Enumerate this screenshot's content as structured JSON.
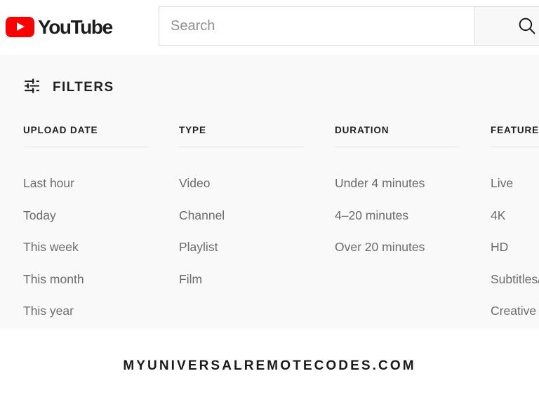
{
  "header": {
    "logo_text": "YouTube",
    "logo_color": "#ff0000",
    "search": {
      "placeholder": "Search",
      "value": "",
      "button_icon": "search-icon"
    }
  },
  "filters": {
    "icon": "tune-icon",
    "title": "FILTERS",
    "columns": [
      {
        "header": "UPLOAD DATE",
        "items": [
          "Last hour",
          "Today",
          "This week",
          "This month",
          "This year"
        ]
      },
      {
        "header": "TYPE",
        "items": [
          "Video",
          "Channel",
          "Playlist",
          "Film"
        ]
      },
      {
        "header": "DURATION",
        "items": [
          "Under 4 minutes",
          "4–20 minutes",
          "Over 20 minutes"
        ]
      },
      {
        "header": "FEATURES",
        "items": [
          "Live",
          "4K",
          "HD",
          "Subtitles/CC",
          "Creative Commons"
        ]
      }
    ]
  },
  "footer": {
    "watermark": "MYUNIVERSALREMOTECODES.COM"
  },
  "colors": {
    "panel_background": "#f9f9f9",
    "item_text": "#6b6b6b",
    "header_text": "#212121",
    "rule": "#e2e2e2"
  }
}
